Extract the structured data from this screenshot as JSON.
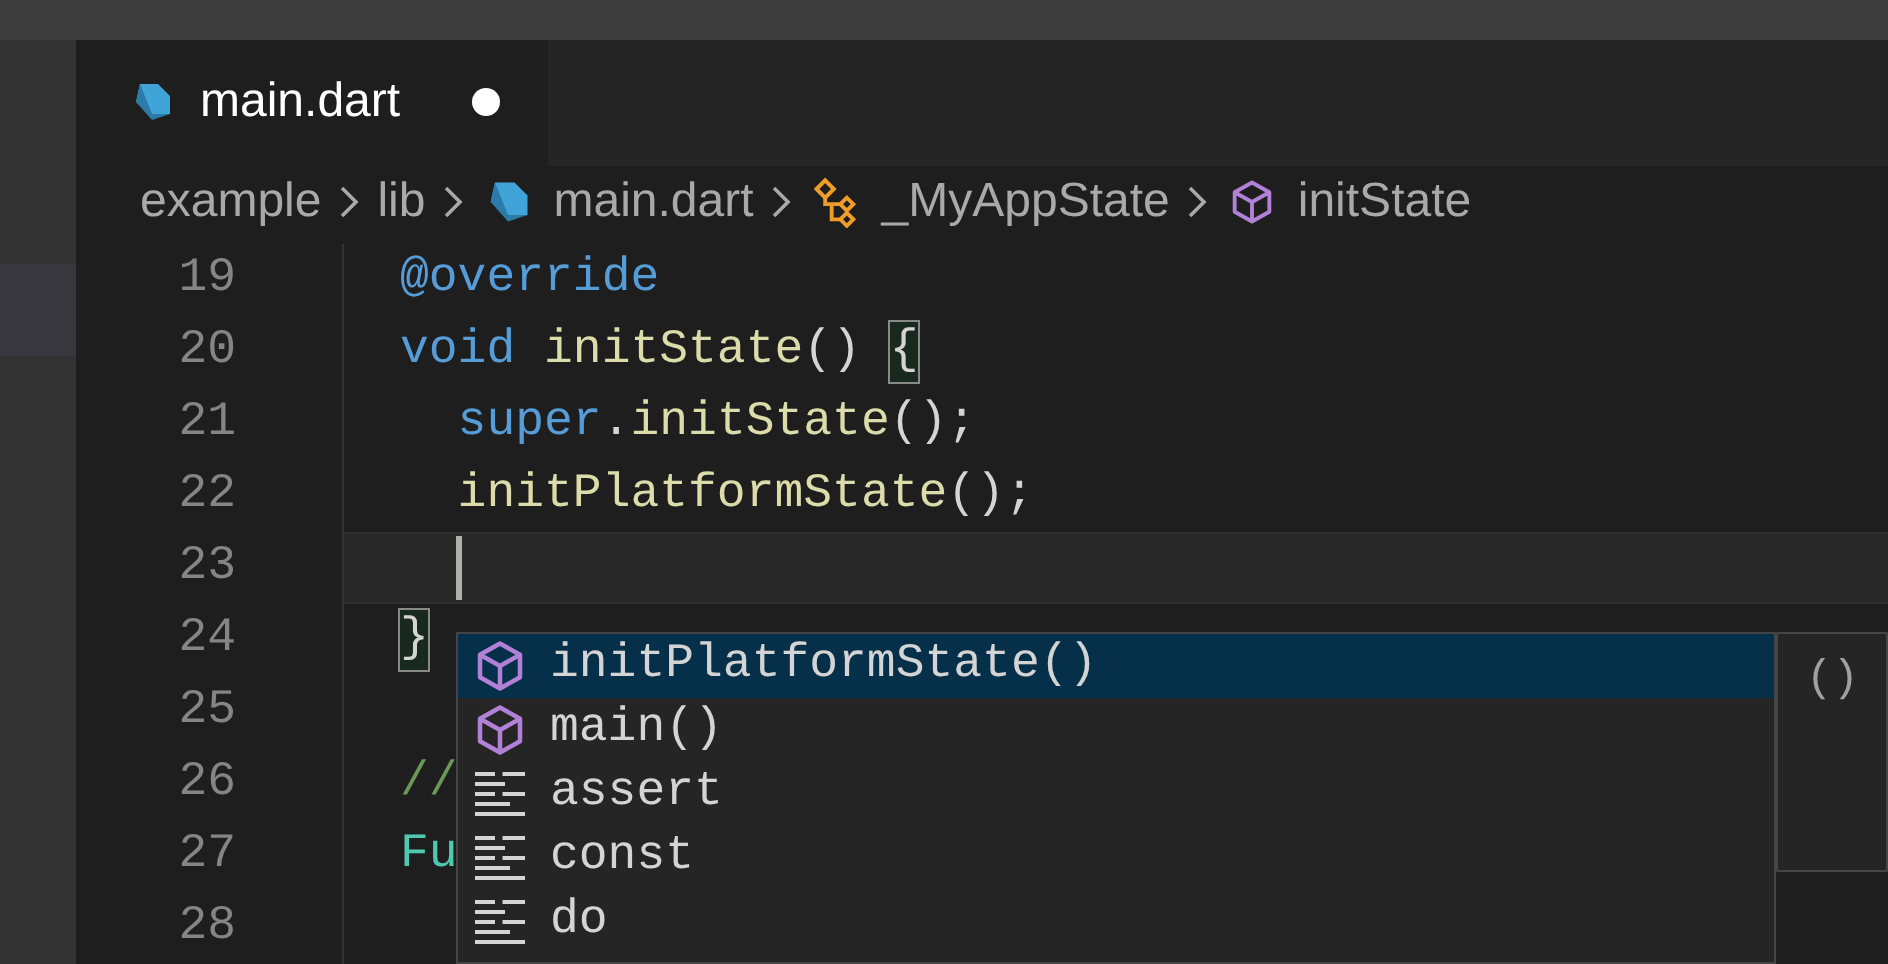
{
  "tabs": [
    {
      "label": "main.dart",
      "modified": true,
      "selected": true
    }
  ],
  "breadcrumb": [
    {
      "label": "example",
      "kind": "folder"
    },
    {
      "label": "lib",
      "kind": "folder"
    },
    {
      "label": "main.dart",
      "kind": "file"
    },
    {
      "label": "_MyAppState",
      "kind": "class"
    },
    {
      "label": "initState",
      "kind": "method"
    }
  ],
  "lines": [
    {
      "number": "19",
      "current": false,
      "tokens": [
        {
          "text": "@override",
          "kind": "keyword"
        }
      ]
    },
    {
      "number": "20",
      "current": false,
      "tokens": [
        {
          "text": "void",
          "kind": "keyword"
        },
        {
          "text": " initState",
          "kind": "function"
        },
        {
          "text": "() ",
          "kind": "plain"
        },
        {
          "text": "{",
          "kind": "bracket_match"
        }
      ]
    },
    {
      "number": "21",
      "current": false,
      "tokens": [
        {
          "text": "  super",
          "kind": "keyword"
        },
        {
          "text": ".",
          "kind": "plain"
        },
        {
          "text": "initState",
          "kind": "function"
        },
        {
          "text": "();",
          "kind": "plain"
        }
      ]
    },
    {
      "number": "22",
      "current": false,
      "tokens": [
        {
          "text": "  initPlatformState",
          "kind": "function"
        },
        {
          "text": "();",
          "kind": "plain"
        }
      ]
    },
    {
      "number": "23",
      "current": true
    },
    {
      "number": "24",
      "current": false,
      "tokens": [
        {
          "text": "}",
          "kind": "bracket_match"
        }
      ]
    },
    {
      "number": "25",
      "current": false
    },
    {
      "number": "26",
      "current": false,
      "tokens": [
        {
          "text": "//",
          "kind": "comment"
        }
      ]
    },
    {
      "number": "27",
      "current": false,
      "tokens": [
        {
          "text": "Fu",
          "kind": "type"
        }
      ]
    },
    {
      "number": "28",
      "current": false
    }
  ],
  "suggestions": [
    {
      "label": "initPlatformState()",
      "kind": "method",
      "selected": true
    },
    {
      "label": "main()",
      "kind": "method",
      "selected": false
    },
    {
      "label": "assert",
      "kind": "keyword",
      "selected": false
    },
    {
      "label": "const",
      "kind": "keyword",
      "selected": false
    },
    {
      "label": "do",
      "kind": "keyword",
      "selected": false
    }
  ],
  "suggestion_details": "()"
}
